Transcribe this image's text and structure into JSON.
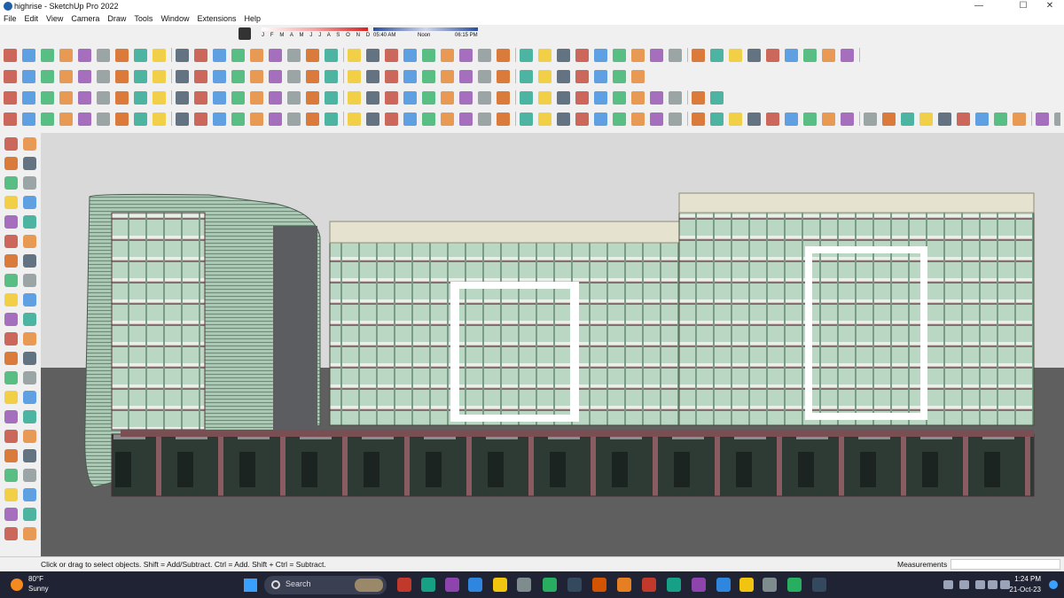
{
  "window": {
    "title": "highrise - SketchUp Pro 2022",
    "minimize": "—",
    "maximize": "☐",
    "close": "✕"
  },
  "menu": [
    "File",
    "Edit",
    "View",
    "Camera",
    "Draw",
    "Tools",
    "Window",
    "Extensions",
    "Help"
  ],
  "shadow": {
    "months": "J F M A M J J A S O N D",
    "time_start": "05:40 AM",
    "time_noon": "Noon",
    "time_end": "06:15 PM"
  },
  "statusbar": {
    "hint": "Click or drag to select objects. Shift = Add/Subtract. Ctrl = Add. Shift + Ctrl = Subtract.",
    "measurements_label": "Measurements"
  },
  "taskbar": {
    "temperature": "80°F",
    "condition": "Sunny",
    "search_label": "Search",
    "time": "1:24 PM",
    "date": "21-Oct-23"
  },
  "colors": {
    "accent": "#d0e4d6",
    "glass": "#b7d6c1",
    "frame": "#6c4a4d",
    "ground": "#5f5f5f",
    "sky": "#d7d7d7",
    "taskbar": "#1f2333"
  },
  "icons": {
    "row1": [
      "move-icon",
      "arc-icon",
      "freehand-icon",
      "eraser-icon",
      "pushpull-icon",
      "offset-icon",
      "follow-me-icon",
      "rotate-icon",
      "scale-icon",
      "sandbox-icon",
      "smoove-icon",
      "stamp-icon",
      "drape-icon",
      "add-detail-icon",
      "flip-edge-icon",
      "section-icon",
      "section-fill-icon",
      "dimension-icon",
      "text-icon",
      "axes-icon",
      "3d-text-icon",
      "paint-icon",
      "tape-icon",
      "protractor-icon",
      "look-around-icon",
      "walk-icon",
      "position-camera-icon",
      "orbit-icon",
      "pan-icon",
      "zoom-icon",
      "zoom-window-icon",
      "zoom-extents-icon",
      "previous-view-icon",
      "next-view-icon",
      "iso-view-icon",
      "top-view-icon",
      "front-view-icon",
      "right-view-icon",
      "back-view-icon",
      "left-view-icon",
      "perspective-icon",
      "component-icon",
      "group-icon",
      "house-icon",
      "warehouse-icon",
      "home-icon",
      "extension-icon"
    ],
    "row2": [
      "search-icon",
      "select-icon",
      "eraser-icon",
      "pencil-icon",
      "arc-icon",
      "shape-icon",
      "pushpull-icon",
      "move-icon",
      "rotate-icon",
      "scale-icon",
      "follow-me-icon",
      "offset-icon",
      "tape-icon",
      "text-icon",
      "paint-icon",
      "orbit-icon",
      "pan-icon",
      "zoom-icon",
      "zoom-extents-icon",
      "style-icon",
      "wireframe-icon",
      "xray-icon",
      "hidden-line-icon",
      "shaded-icon",
      "textured-icon",
      "sun-icon",
      "solid-union-icon",
      "solid-subtract-icon",
      "solid-intersect-icon",
      "solid-trim-icon",
      "solid-split-icon",
      "outer-shell-icon",
      "layer-icon",
      "scene-icon"
    ],
    "row3": [
      "select-icon",
      "component-icon",
      "group-icon",
      "paint-icon",
      "hide-icon",
      "unhide-icon",
      "lock-icon",
      "unlock-icon",
      "explode-icon",
      "edit-icon",
      "ruler-icon",
      "line-icon",
      "rectangle-icon",
      "rotated-rect-icon",
      "circle-icon",
      "polygon-icon",
      "arc-2pt-icon",
      "arc-3pt-icon",
      "pie-icon",
      "freehand-icon",
      "pushpull-icon",
      "offset-icon",
      "follow-me-icon",
      "intersect-icon",
      "outliner-icon",
      "entity-info-icon",
      "materials-icon",
      "layers-icon",
      "scenes-icon",
      "shadows-icon",
      "fog-icon",
      "soften-icon",
      "styles-icon",
      "instructor-icon",
      "ruby-icon",
      "dynamic-icon",
      "photo-icon",
      "model-info-icon"
    ],
    "row4": [
      "axes-icon",
      "rotate-icon",
      "circle-icon",
      "angle-icon",
      "grid-icon",
      "pie-icon",
      "settings-icon",
      "box-icon",
      "cube-icon",
      "cylinder-icon",
      "cone-icon",
      "sphere-icon",
      "torus-icon",
      "plane-icon",
      "wedge-icon",
      "extrude-icon",
      "loft-icon",
      "sweep-icon",
      "revolve-icon",
      "shell-icon",
      "fillet-icon",
      "chamfer-icon",
      "mirror-icon",
      "array-icon",
      "align-icon",
      "distribute-icon",
      "weld-icon",
      "split-icon",
      "join-icon",
      "pipe-icon",
      "tube-icon",
      "stair-icon",
      "roof-icon",
      "wall-icon",
      "window-icon",
      "door-icon",
      "column-icon",
      "beam-icon",
      "slab-icon",
      "railing-icon",
      "curtain-icon",
      "furniture-icon",
      "tree-icon",
      "car-icon",
      "person-icon",
      "label-icon",
      "tag-icon",
      "export-icon",
      "import-icon",
      "render-icon",
      "light-icon",
      "camera-icon",
      "material-icon",
      "texture-icon",
      "uv-icon",
      "section-icon",
      "dimension-icon",
      "grid2-icon",
      "snap-icon",
      "guide-icon"
    ],
    "left": [
      "select-icon",
      "orbit-icon",
      "paint-icon",
      "eraser-icon",
      "component-icon",
      "tag-icon",
      "pencil-icon",
      "freehand-icon",
      "rectangle-icon",
      "rotated-rect-icon",
      "circle-icon",
      "polygon-icon",
      "arc-icon",
      "pie-icon",
      "arc-3pt-icon",
      "arc-2pt-icon",
      "move-icon",
      "pushpull-icon",
      "rotate-icon",
      "follow-me-icon",
      "scale-icon",
      "offset-icon",
      "tape-icon",
      "dimension-icon",
      "protractor-icon",
      "text-icon",
      "axes-icon",
      "3d-text-icon",
      "section-icon",
      "walk-icon",
      "zoom-icon",
      "zoom-extents-icon",
      "zoom-window-icon",
      "pan-icon",
      "position-camera-icon",
      "look-around-icon",
      "walk-person-icon",
      "follow-icon",
      "sandbox-icon",
      "smoove-icon",
      "stamp-icon",
      "drape-icon"
    ],
    "taskbar": [
      "windows-start-icon",
      "search-icon",
      "widgets-icon",
      "task-view-icon",
      "chat-icon",
      "calendar-icon",
      "notes-icon",
      "files-icon",
      "office-icon",
      "telegram-icon",
      "store-icon",
      "brave-icon",
      "vscode-icon",
      "sketchup-icon",
      "photoshop-icon",
      "chrome-icon",
      "pinterest-icon",
      "soundcloud-icon",
      "sketchup2-icon"
    ],
    "tray": [
      "chevron-up-icon",
      "shield-icon",
      "network-icon",
      "wifi-icon",
      "speaker-icon",
      "battery-icon",
      "notification-icon"
    ]
  }
}
